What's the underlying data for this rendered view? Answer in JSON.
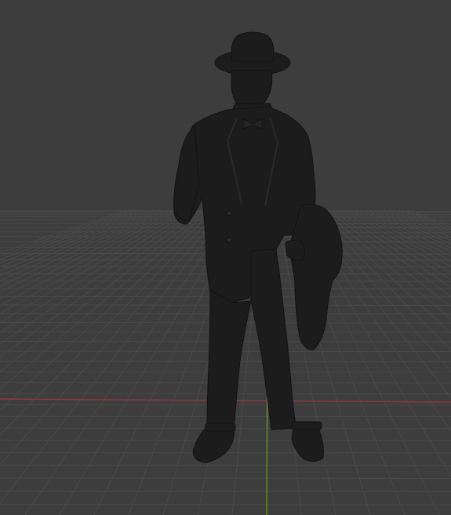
{
  "viewport": {
    "background_color": "#3d3d3d",
    "grid_color": "#4a4a4a",
    "x_axis_color": "#8b3a3f",
    "y_axis_color": "#6a8a25",
    "model_color": "#1c1c1c",
    "model_shadow_color": "#141414"
  },
  "scene": {
    "object": "figurine-model",
    "shading": "solid"
  }
}
